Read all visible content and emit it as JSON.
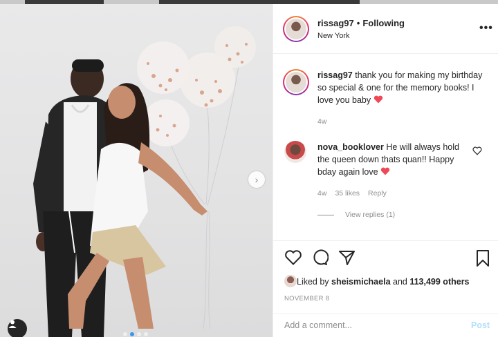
{
  "post": {
    "username": "rissag97",
    "separator": "•",
    "follow_status": "Following",
    "location": "New York",
    "more_icon": "more-horizontal-icon"
  },
  "caption": {
    "username": "rissag97",
    "text": "thank you for making my birthday so special & one for the memory books! I love you baby",
    "emoji": "red-heart",
    "age": "4w"
  },
  "reply": {
    "username": "nova_booklover",
    "text": "He will always hold the queen down thats quan!! Happy bday again love",
    "emoji": "red-heart",
    "age": "4w",
    "likes": "35 likes",
    "reply_label": "Reply",
    "view_replies": "View replies (1)"
  },
  "actions": {
    "icons": [
      "heart-icon",
      "comment-icon",
      "share-icon",
      "bookmark-icon"
    ]
  },
  "likes": {
    "prefix": "Liked by",
    "user": "sheismichaela",
    "and": "and",
    "count": "113,499 others"
  },
  "date": "NOVEMBER 8",
  "comment_box": {
    "placeholder": "Add a comment...",
    "post_label": "Post"
  },
  "carousel": {
    "slides": 4,
    "active_index": 1
  },
  "colors": {
    "heart_red": "#ed4956",
    "post_disabled": "#b2dffc",
    "muted": "#8e8e8e"
  }
}
